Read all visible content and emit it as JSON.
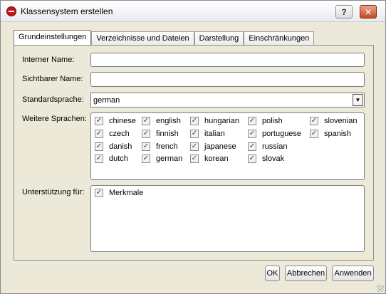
{
  "window": {
    "title": "Klassensystem erstellen"
  },
  "titlebar_buttons": {
    "help": "?",
    "close": "✕"
  },
  "tabs": [
    {
      "label": "Grundeinstellungen",
      "active": true
    },
    {
      "label": "Verzeichnisse und Dateien",
      "active": false
    },
    {
      "label": "Darstellung",
      "active": false
    },
    {
      "label": "Einschränkungen",
      "active": false
    }
  ],
  "form": {
    "internal_name_label": "Interner Name:",
    "internal_name_value": "",
    "visible_name_label": "Sichtbarer Name:",
    "visible_name_value": "",
    "standard_language_label": "Standardsprache:",
    "standard_language_value": "german",
    "more_languages_label": "Weitere Sprachen:",
    "languages": [
      {
        "label": "chinese",
        "checked": true
      },
      {
        "label": "english",
        "checked": true
      },
      {
        "label": "hungarian",
        "checked": true
      },
      {
        "label": "polish",
        "checked": true
      },
      {
        "label": "slovenian",
        "checked": true
      },
      {
        "label": "czech",
        "checked": true
      },
      {
        "label": "finnish",
        "checked": true
      },
      {
        "label": "italian",
        "checked": true
      },
      {
        "label": "portuguese",
        "checked": true
      },
      {
        "label": "spanish",
        "checked": true
      },
      {
        "label": "danish",
        "checked": true
      },
      {
        "label": "french",
        "checked": true
      },
      {
        "label": "japanese",
        "checked": true
      },
      {
        "label": "russian",
        "checked": true
      },
      {
        "label": "dutch",
        "checked": true
      },
      {
        "label": "german",
        "checked": true
      },
      {
        "label": "korean",
        "checked": true
      },
      {
        "label": "slovak",
        "checked": true
      }
    ],
    "support_label": "Unterstützung für:",
    "support_items": [
      {
        "label": "Merkmale",
        "checked": true
      }
    ]
  },
  "buttons": {
    "ok": "OK",
    "cancel": "Abbrechen",
    "apply": "Anwenden"
  },
  "icons": {
    "app": "app-logo-icon",
    "help": "help-icon",
    "close": "close-icon",
    "dropdown": "chevron-down-icon",
    "check": "checkmark-icon"
  }
}
